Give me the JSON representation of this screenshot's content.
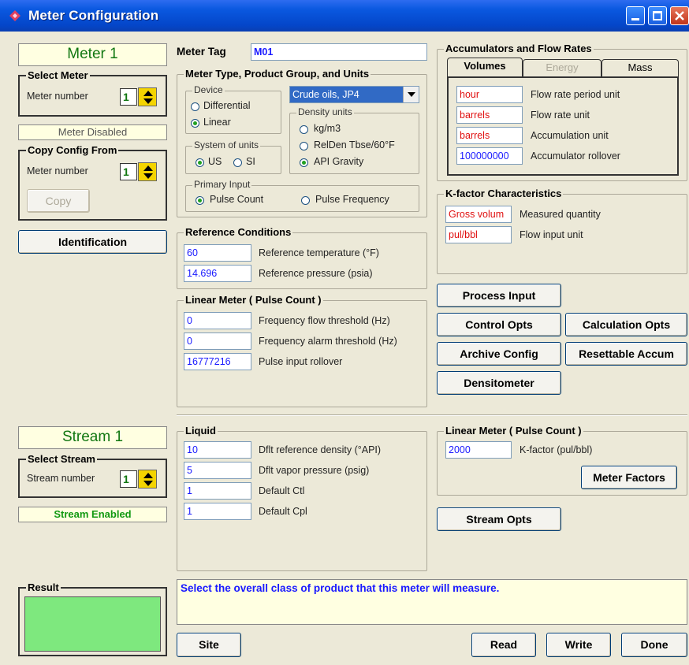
{
  "window": {
    "title": "Meter Configuration"
  },
  "meter": {
    "header": "Meter 1",
    "select_title": "Select Meter",
    "number_label": "Meter number",
    "number_value": "1",
    "disabled_status": "Meter Disabled",
    "copy_title": "Copy Config From",
    "copy_number_label": "Meter number",
    "copy_number_value": "1",
    "copy_button": "Copy",
    "identification_button": "Identification"
  },
  "meter_tag": {
    "label": "Meter Tag",
    "value": "M01"
  },
  "meter_type": {
    "title": "Meter Type, Product Group, and Units",
    "device_title": "Device",
    "device_options": [
      "Differential",
      "Linear"
    ],
    "device_selected": "Linear",
    "product_group": "Crude oils, JP4",
    "density_title": "Density units",
    "density_options": [
      "kg/m3",
      "RelDen Tbse/60°F",
      "API Gravity"
    ],
    "density_selected": "API Gravity",
    "system_title": "System of units",
    "system_options": [
      "US",
      "SI"
    ],
    "system_selected": "US",
    "primary_title": "Primary Input",
    "primary_options": [
      "Pulse Count",
      "Pulse Frequency"
    ],
    "primary_selected": "Pulse Count"
  },
  "reference": {
    "title": "Reference Conditions",
    "rows": [
      {
        "value": "60",
        "label": "Reference temperature (°F)"
      },
      {
        "value": "14.696",
        "label": "Reference pressure (psia)"
      }
    ]
  },
  "linear_meter": {
    "title": "Linear Meter ( Pulse Count )",
    "rows": [
      {
        "value": "0",
        "label": "Frequency flow threshold (Hz)"
      },
      {
        "value": "0",
        "label": "Frequency alarm threshold (Hz)"
      },
      {
        "value": "16777216",
        "label": "Pulse input rollover"
      }
    ]
  },
  "accumulators": {
    "title": "Accumulators and Flow Rates",
    "tabs": [
      "Volumes",
      "Energy",
      "Mass"
    ],
    "active_tab": "Volumes",
    "rows": [
      {
        "value": "hour",
        "label": "Flow rate period unit",
        "color": "red"
      },
      {
        "value": "barrels",
        "label": "Flow rate unit",
        "color": "red"
      },
      {
        "value": "barrels",
        "label": "Accumulation unit",
        "color": "red"
      },
      {
        "value": "100000000",
        "label": "Accumulator rollover",
        "color": "blue"
      }
    ]
  },
  "kfactor": {
    "title": "K-factor Characteristics",
    "rows": [
      {
        "value": "Gross volum",
        "label": "Measured quantity"
      },
      {
        "value": "pul/bbl",
        "label": "Flow input unit"
      }
    ]
  },
  "buttons": {
    "process_input": "Process Input",
    "control_opts": "Control Opts",
    "calculation_opts": "Calculation Opts",
    "archive_config": "Archive Config",
    "resettable_accum": "Resettable Accum",
    "densitometer": "Densitometer",
    "meter_factors": "Meter Factors",
    "stream_opts": "Stream Opts",
    "site": "Site",
    "read": "Read",
    "write": "Write",
    "done": "Done"
  },
  "stream": {
    "header": "Stream 1",
    "select_title": "Select Stream",
    "number_label": "Stream number",
    "number_value": "1",
    "enabled_status": "Stream Enabled"
  },
  "liquid": {
    "title": "Liquid",
    "rows": [
      {
        "value": "10",
        "label": "Dflt reference density (°API)"
      },
      {
        "value": "5",
        "label": "Dflt vapor pressure (psig)"
      },
      {
        "value": "1",
        "label": "Default Ctl"
      },
      {
        "value": "1",
        "label": "Default Cpl"
      }
    ]
  },
  "stream_linear": {
    "title": "Linear Meter ( Pulse Count )",
    "kfactor_value": "2000",
    "kfactor_label": "K-factor (pul/bbl)"
  },
  "result": {
    "title": "Result",
    "color": "#7ee87e"
  },
  "hint": "Select the overall class of product that this meter will measure.",
  "colors": {
    "title_bar": "#0a58e0",
    "value_blue": "#1a1aff",
    "value_red": "#e01010",
    "header_green": "#117711"
  }
}
